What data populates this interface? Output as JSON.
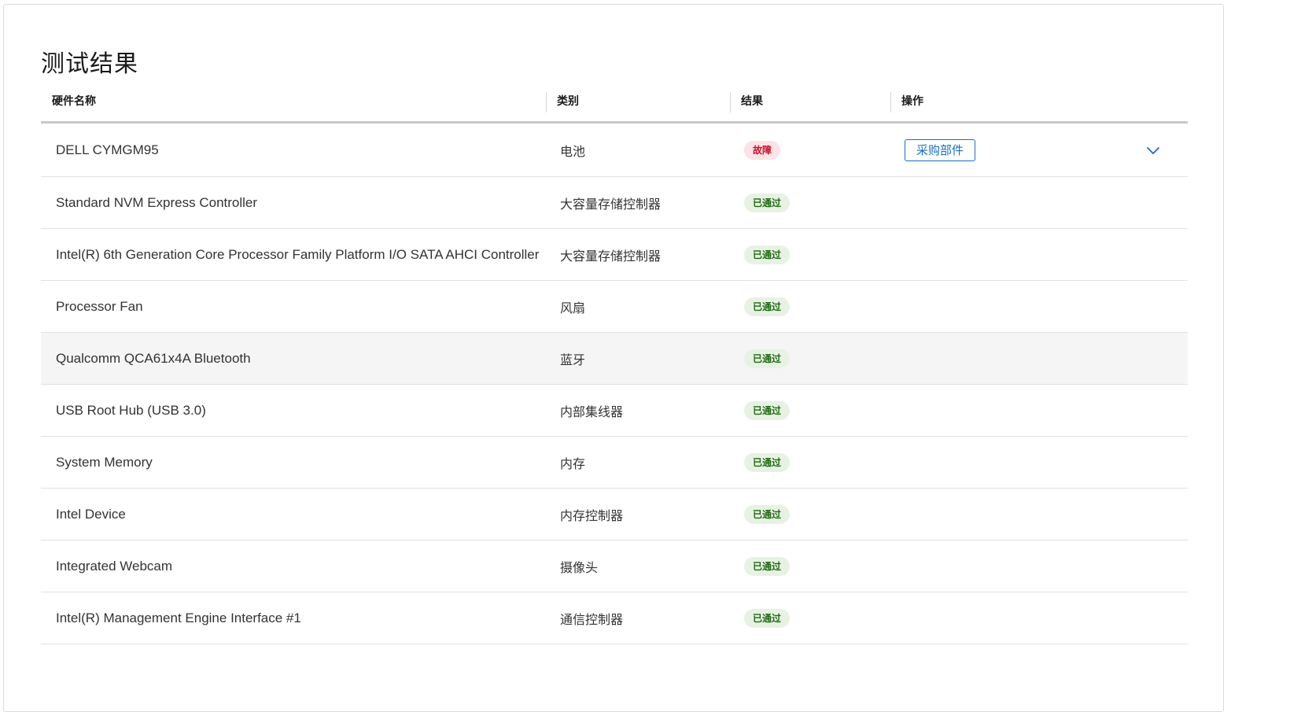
{
  "page": {
    "title": "测试结果"
  },
  "table": {
    "headers": {
      "name": "硬件名称",
      "category": "类别",
      "result": "结果",
      "action": "操作"
    },
    "rows": [
      {
        "name": "DELL CYMGM95",
        "category": "电池",
        "result": "故障",
        "status": "fail",
        "action": "采购部件"
      },
      {
        "name": "Standard NVM Express Controller",
        "category": "大容量存储控制器",
        "result": "已通过",
        "status": "pass"
      },
      {
        "name": "Intel(R) 6th Generation Core Processor Family Platform I/O SATA AHCI Controller",
        "category": "大容量存储控制器",
        "result": "已通过",
        "status": "pass"
      },
      {
        "name": "Processor Fan",
        "category": "风扇",
        "result": "已通过",
        "status": "pass"
      },
      {
        "name": "Qualcomm QCA61x4A Bluetooth",
        "category": "蓝牙",
        "result": "已通过",
        "status": "pass"
      },
      {
        "name": "USB Root Hub (USB 3.0)",
        "category": "内部集线器",
        "result": "已通过",
        "status": "pass"
      },
      {
        "name": "System Memory",
        "category": "内存",
        "result": "已通过",
        "status": "pass"
      },
      {
        "name": "Intel Device",
        "category": "内存控制器",
        "result": "已通过",
        "status": "pass"
      },
      {
        "name": "Integrated Webcam",
        "category": "摄像头",
        "result": "已通过",
        "status": "pass"
      },
      {
        "name": "Intel(R) Management Engine Interface #1",
        "category": "通信控制器",
        "result": "已通过",
        "status": "pass"
      }
    ]
  },
  "icons": {
    "expand": "chevron-down-icon"
  },
  "colors": {
    "accent": "#1a6ec2",
    "pass_bg": "#e8f2e4",
    "pass_text": "#1e6b12",
    "fail_bg": "#fbe3e6",
    "fail_text": "#c8102e"
  }
}
